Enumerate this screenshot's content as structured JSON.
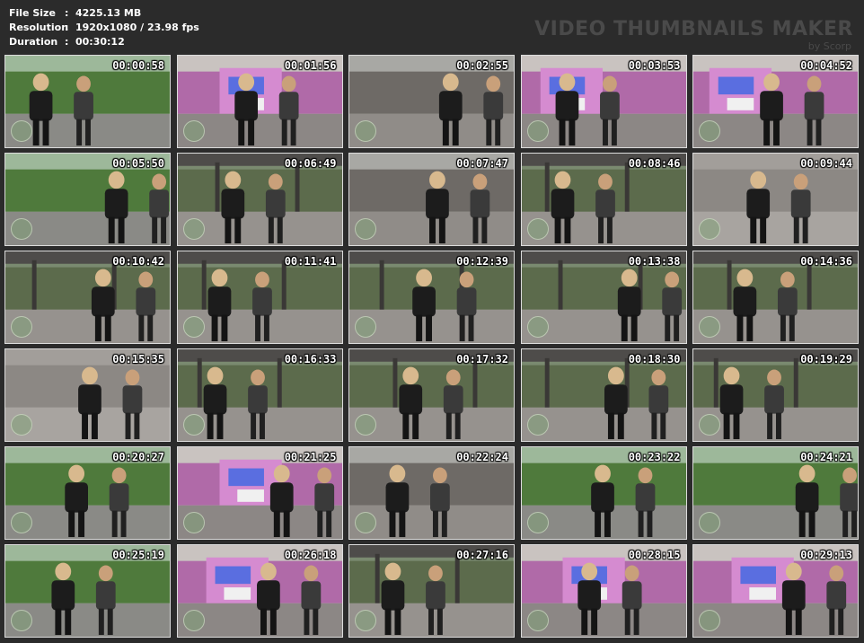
{
  "info": {
    "rows": [
      {
        "key": "File Size",
        "sep": ":",
        "value": "4225.13 MB"
      },
      {
        "key": "Resolution",
        "sep": ":",
        "value": "1920x1080 / 23.98 fps"
      },
      {
        "key": "Duration",
        "sep": ":",
        "value": "00:30:12"
      }
    ]
  },
  "watermark": {
    "title": "VIDEO THUMBNAILS MAKER",
    "sub": "by Scorp"
  },
  "thumbnails": [
    {
      "time": "00:00:58",
      "scene": "park"
    },
    {
      "time": "00:01:56",
      "scene": "graffiti"
    },
    {
      "time": "00:02:55",
      "scene": "closeup"
    },
    {
      "time": "00:03:53",
      "scene": "graffiti"
    },
    {
      "time": "00:04:52",
      "scene": "graffiti"
    },
    {
      "time": "00:05:50",
      "scene": "park"
    },
    {
      "time": "00:06:49",
      "scene": "hall"
    },
    {
      "time": "00:07:47",
      "scene": "closeup"
    },
    {
      "time": "00:08:46",
      "scene": "hall"
    },
    {
      "time": "00:09:44",
      "scene": "floor"
    },
    {
      "time": "00:10:42",
      "scene": "hall"
    },
    {
      "time": "00:11:41",
      "scene": "hall"
    },
    {
      "time": "00:12:39",
      "scene": "hall"
    },
    {
      "time": "00:13:38",
      "scene": "hall"
    },
    {
      "time": "00:14:36",
      "scene": "hall"
    },
    {
      "time": "00:15:35",
      "scene": "floor"
    },
    {
      "time": "00:16:33",
      "scene": "hall"
    },
    {
      "time": "00:17:32",
      "scene": "hall"
    },
    {
      "time": "00:18:30",
      "scene": "hall"
    },
    {
      "time": "00:19:29",
      "scene": "hall"
    },
    {
      "time": "00:20:27",
      "scene": "park"
    },
    {
      "time": "00:21:25",
      "scene": "graffiti"
    },
    {
      "time": "00:22:24",
      "scene": "closeup"
    },
    {
      "time": "00:23:22",
      "scene": "park"
    },
    {
      "time": "00:24:21",
      "scene": "park"
    },
    {
      "time": "00:25:19",
      "scene": "park"
    },
    {
      "time": "00:26:18",
      "scene": "graffiti"
    },
    {
      "time": "00:27:16",
      "scene": "hall"
    },
    {
      "time": "00:28:15",
      "scene": "graffiti"
    },
    {
      "time": "00:29:13",
      "scene": "graffiti"
    }
  ]
}
